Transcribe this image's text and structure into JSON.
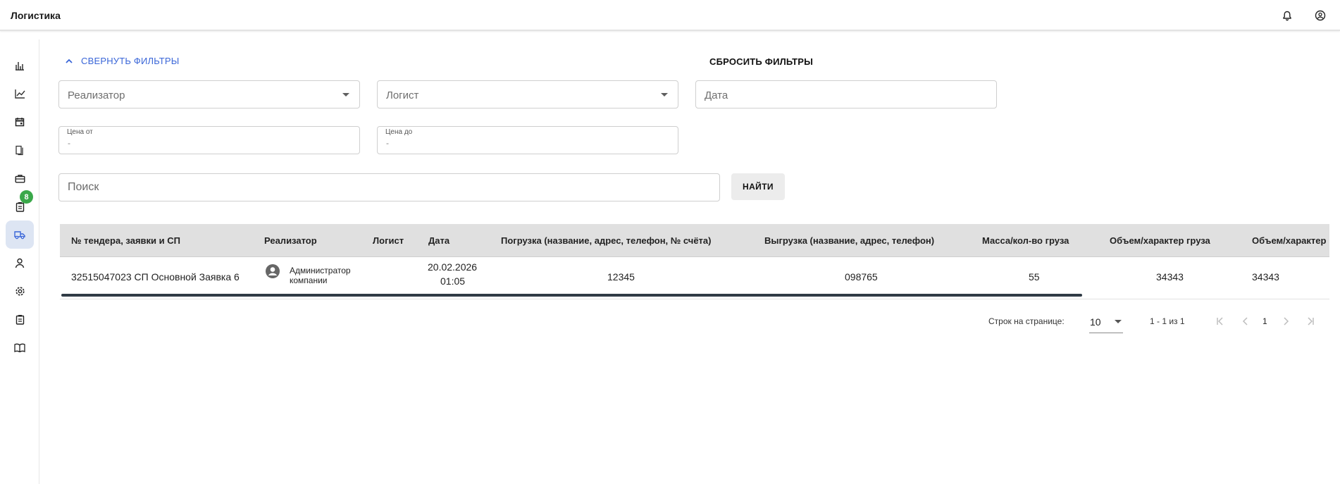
{
  "app": {
    "title": "Логистика"
  },
  "filters": {
    "collapse_label": "СВЕРНУТЬ ФИЛЬТРЫ",
    "reset_label": "СБРОСИТЬ ФИЛЬТРЫ",
    "realizer_placeholder": "Реализатор",
    "logist_placeholder": "Логист",
    "date_placeholder": "Дата",
    "price_from_label": "Цена от",
    "price_from_value": "-",
    "price_to_label": "Цена до",
    "price_to_value": "-",
    "search_placeholder": "Поиск",
    "find_label": "НАЙТИ"
  },
  "sidebar": {
    "badge": "8",
    "items": [
      {
        "icon": "bar-chart-icon"
      },
      {
        "icon": "line-chart-icon"
      },
      {
        "icon": "calendar-icon"
      },
      {
        "icon": "documents-icon"
      },
      {
        "icon": "briefcase-icon"
      },
      {
        "icon": "clipboard-icon"
      },
      {
        "icon": "truck-icon"
      },
      {
        "icon": "person-icon"
      },
      {
        "icon": "settings-icon"
      },
      {
        "icon": "clipboard-list-icon"
      },
      {
        "icon": "book-icon"
      }
    ]
  },
  "table": {
    "columns": [
      "№ тендера, заявки и СП",
      "Реализатор",
      "Логист",
      "Дата",
      "Погрузка (название, адрес, телефон, № счёта)",
      "Выгрузка (название, адрес, телефон)",
      "Масса/кол-во груза",
      "Объем/характер груза",
      "Объем/характер"
    ],
    "rows": [
      {
        "tender": "32515047023 СП Основной Заявка 6",
        "realizer_line1": "Администратор",
        "realizer_line2": "компании",
        "logist": "",
        "date_line1": "20.02.2026",
        "date_line2": "01:05",
        "loading": "12345",
        "unloading": "098765",
        "mass": "55",
        "volume": "34343",
        "volume2": "34343"
      }
    ]
  },
  "pagination": {
    "rows_per_page_label": "Строк на странице:",
    "rows_per_page_value": "10",
    "range": "1 - 1 из 1",
    "current_page": "1"
  },
  "colors": {
    "accent": "#3a66d8",
    "badge": "#3aa84a",
    "header_bg": "#e0e0e0",
    "active_nav": "#dde5f3"
  }
}
